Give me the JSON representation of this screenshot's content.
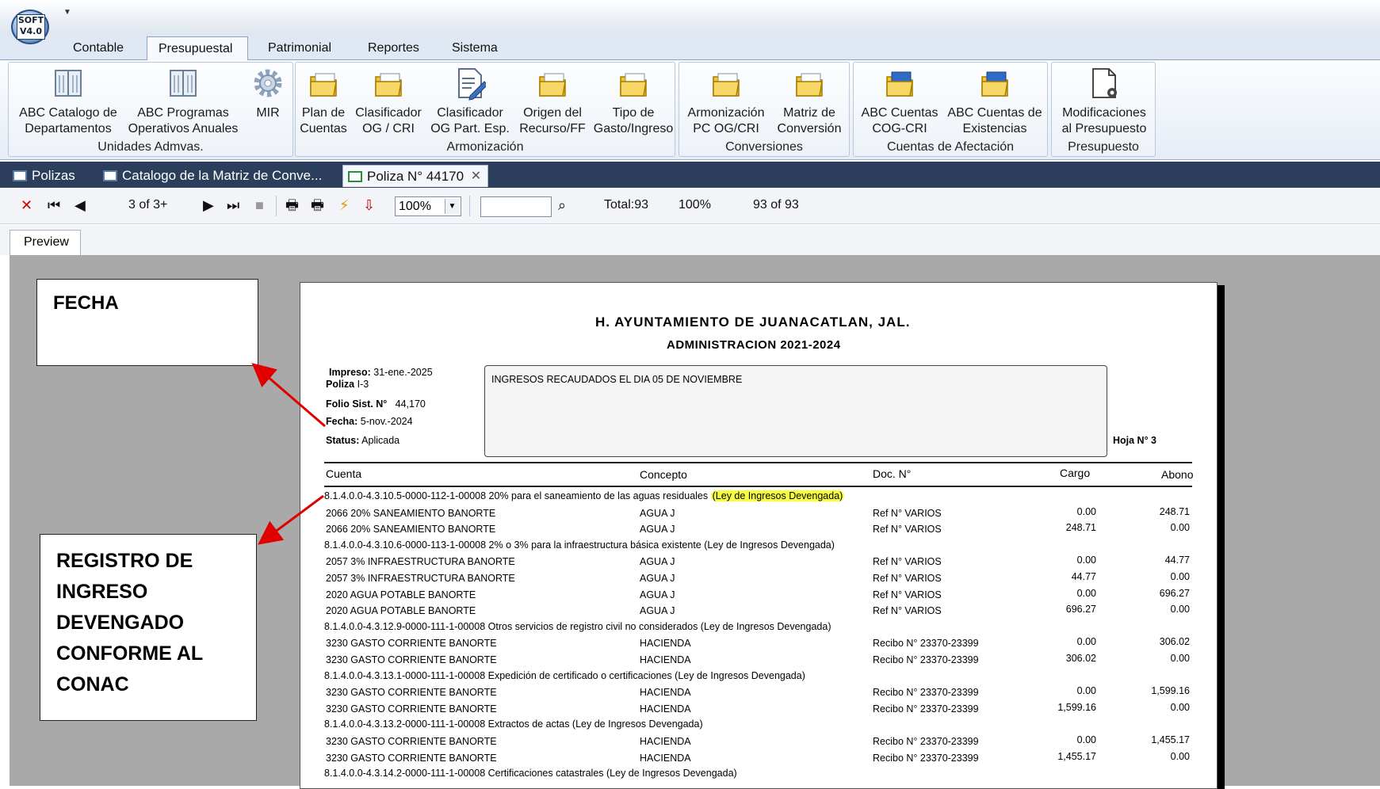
{
  "app": {
    "logo_text": "SOFT V4.0"
  },
  "ribbon_tabs": [
    "Contable",
    "Presupuestal",
    "Patrimonial",
    "Reportes",
    "Sistema"
  ],
  "ribbon_groups": [
    {
      "title": "Unidades Admvas.",
      "buttons": [
        {
          "l1": "ABC Catalogo de",
          "l2": "Departamentos",
          "icon": "book-icon"
        },
        {
          "l1": "ABC Programas",
          "l2": "Operativos Anuales",
          "icon": "book-icon"
        },
        {
          "l1": "MIR",
          "l2": "",
          "icon": "gear-icon"
        }
      ]
    },
    {
      "title": "Armonización",
      "buttons": [
        {
          "l1": "Plan de",
          "l2": "Cuentas",
          "icon": "folder-icon"
        },
        {
          "l1": "Clasificador",
          "l2": "OG / CRI",
          "icon": "folder-icon"
        },
        {
          "l1": "Clasificador",
          "l2": "OG Part. Esp.",
          "icon": "edit-document-icon"
        },
        {
          "l1": "Origen del",
          "l2": "Recurso/FF",
          "icon": "folder-icon"
        },
        {
          "l1": "Tipo de",
          "l2": "Gasto/Ingreso",
          "icon": "folder-icon"
        }
      ]
    },
    {
      "title": "Conversiones",
      "buttons": [
        {
          "l1": "Armonización",
          "l2": "PC OG/CRI",
          "icon": "folder-icon"
        },
        {
          "l1": "Matriz de",
          "l2": "Conversión",
          "icon": "folder-icon"
        }
      ]
    },
    {
      "title": "Cuentas de Afectación",
      "buttons": [
        {
          "l1": "ABC Cuentas",
          "l2": "COG-CRI",
          "icon": "folder-icon"
        },
        {
          "l1": "ABC Cuentas de",
          "l2": "Existencias",
          "icon": "folder-icon"
        }
      ]
    },
    {
      "title": "Presupuesto",
      "buttons": [
        {
          "l1": "Modificaciones",
          "l2": "al Presupuesto",
          "icon": "document-gear-icon"
        }
      ]
    }
  ],
  "doc_tabs": [
    "Polizas",
    "Catalogo de la Matriz de Conve...",
    "Poliza N° 44170"
  ],
  "toolbar": {
    "page_indicator": "3 of 3+",
    "zoom": "100%",
    "search_value": "",
    "total": "Total:93",
    "percent": "100%",
    "count": "93 of 93"
  },
  "preview_tab": "Preview",
  "callouts": {
    "fecha": "FECHA",
    "registro": [
      "REGISTRO DE",
      "INGRESO",
      "DEVENGADO",
      "CONFORME AL",
      "CONAC"
    ]
  },
  "report": {
    "title": "H. AYUNTAMIENTO DE JUANACATLAN, JAL.",
    "subtitle": "ADMINISTRACION 2021-2024",
    "impreso_label": "Impreso:",
    "impreso_value": "31-ene.-2025",
    "poliza_label": "Poliza",
    "poliza_value": "I-3",
    "folio_label": "Folio Sist. N°",
    "folio_value": "44,170",
    "fecha_label": "Fecha:",
    "fecha_value": "5-nov.-2024",
    "status_label": "Status:",
    "status_value": "Aplicada",
    "concepto_text": "INGRESOS RECAUDADOS EL DIA 05 DE NOVIEMBRE",
    "hoja": "Hoja N° 3",
    "headers": {
      "cuenta": "Cuenta",
      "concepto": "Concepto",
      "doc": "Doc. N°",
      "cargo": "Cargo",
      "abono": "Abono"
    },
    "lines": [
      {
        "kind": "acct",
        "text": "8.1.4.0.0-4.3.10.5-0000-112-1-00008  20% para el saneamiento de las aguas residuales",
        "hl": "(Ley de Ingresos Devengada)"
      },
      {
        "kind": "row",
        "cuenta": "2066 20% SANEAMIENTO BANORTE",
        "concepto": "AGUA J",
        "doc": "Ref N° VARIOS",
        "cargo": "0.00",
        "abono": "248.71"
      },
      {
        "kind": "row",
        "cuenta": "2066 20% SANEAMIENTO BANORTE",
        "concepto": "AGUA J",
        "doc": "Ref N° VARIOS",
        "cargo": "248.71",
        "abono": "0.00"
      },
      {
        "kind": "acct",
        "text": "8.1.4.0.0-4.3.10.6-0000-113-1-00008  2% o 3% para la infraestructura básica existente (Ley de Ingresos Devengada)",
        "hl": ""
      },
      {
        "kind": "row",
        "cuenta": "2057 3% INFRAESTRUCTURA BANORTE",
        "concepto": "AGUA J",
        "doc": "Ref N° VARIOS",
        "cargo": "0.00",
        "abono": "44.77"
      },
      {
        "kind": "row",
        "cuenta": "2057 3% INFRAESTRUCTURA BANORTE",
        "concepto": "AGUA J",
        "doc": "Ref N° VARIOS",
        "cargo": "44.77",
        "abono": "0.00"
      },
      {
        "kind": "row",
        "cuenta": "2020 AGUA POTABLE BANORTE",
        "concepto": "AGUA J",
        "doc": "Ref N° VARIOS",
        "cargo": "0.00",
        "abono": "696.27"
      },
      {
        "kind": "row",
        "cuenta": "2020 AGUA POTABLE BANORTE",
        "concepto": "AGUA J",
        "doc": "Ref N° VARIOS",
        "cargo": "696.27",
        "abono": "0.00"
      },
      {
        "kind": "acct",
        "text": "8.1.4.0.0-4.3.12.9-0000-111-1-00008  Otros servicios de registro civil no considerados (Ley de Ingresos Devengada)",
        "hl": ""
      },
      {
        "kind": "row",
        "cuenta": "3230 GASTO CORRIENTE BANORTE",
        "concepto": "HACIENDA",
        "doc": "Recibo N° 23370-23399",
        "cargo": "0.00",
        "abono": "306.02"
      },
      {
        "kind": "row",
        "cuenta": "3230 GASTO CORRIENTE BANORTE",
        "concepto": "HACIENDA",
        "doc": "Recibo N° 23370-23399",
        "cargo": "306.02",
        "abono": "0.00"
      },
      {
        "kind": "acct",
        "text": "8.1.4.0.0-4.3.13.1-0000-111-1-00008  Expedición de certificado o certificaciones (Ley de Ingresos Devengada)",
        "hl": ""
      },
      {
        "kind": "row",
        "cuenta": "3230 GASTO CORRIENTE BANORTE",
        "concepto": "HACIENDA",
        "doc": "Recibo N° 23370-23399",
        "cargo": "0.00",
        "abono": "1,599.16"
      },
      {
        "kind": "row",
        "cuenta": "3230 GASTO CORRIENTE BANORTE",
        "concepto": "HACIENDA",
        "doc": "Recibo N° 23370-23399",
        "cargo": "1,599.16",
        "abono": "0.00"
      },
      {
        "kind": "acct",
        "text": "8.1.4.0.0-4.3.13.2-0000-111-1-00008  Extractos de actas (Ley de Ingresos Devengada)",
        "hl": ""
      },
      {
        "kind": "row",
        "cuenta": "3230 GASTO CORRIENTE BANORTE",
        "concepto": "HACIENDA",
        "doc": "Recibo N° 23370-23399",
        "cargo": "0.00",
        "abono": "1,455.17"
      },
      {
        "kind": "row",
        "cuenta": "3230 GASTO CORRIENTE BANORTE",
        "concepto": "HACIENDA",
        "doc": "Recibo N° 23370-23399",
        "cargo": "1,455.17",
        "abono": "0.00"
      },
      {
        "kind": "acct",
        "text": "8.1.4.0.0-4.3.14.2-0000-111-1-00008  Certificaciones catastrales (Ley de Ingresos Devengada)",
        "hl": ""
      }
    ]
  },
  "colors": {
    "doc_tab_bar": "#2b3f5c",
    "canvas": "#a9a9a9",
    "highlight": "#f7ff3c",
    "arrow": "#e00000"
  }
}
